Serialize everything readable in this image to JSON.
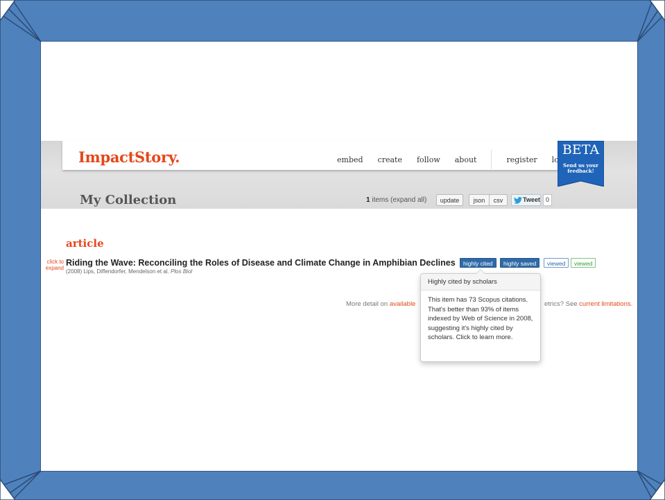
{
  "site": {
    "logo": "ImpactStory."
  },
  "nav": {
    "embed": "embed",
    "create": "create",
    "follow": "follow",
    "about": "about",
    "register": "register",
    "login": "log in"
  },
  "beta": {
    "label": "BETA",
    "line1": "Send us your",
    "line2": "feedback!"
  },
  "collection": {
    "title": "My Collection",
    "item_count": "1",
    "items_text": "items",
    "expand_all": "(expand all)",
    "update": "update",
    "json": "json",
    "csv": "csv",
    "tweet": "Tweet",
    "tweet_count": "0"
  },
  "section": "article",
  "article": {
    "expand_line1": "click to",
    "expand_line2": "expand",
    "title": "Riding the Wave: Reconciling the Roles of Disease and Climate Change in Amphibian Declines",
    "meta": "(2008) Lips, Diffendorfer, Mendelson et al.",
    "journal": "Plos Biol"
  },
  "badges": [
    {
      "label": "highly cited"
    },
    {
      "label": "highly saved"
    },
    {
      "label": "viewed"
    },
    {
      "label": "viewed"
    }
  ],
  "more_detail": {
    "prefix": "More detail on",
    "link1": "available",
    "middle": "etrics? See",
    "link2": "current limitations."
  },
  "popover": {
    "title": "Highly cited by scholars",
    "body": "This item has 73 Scopus citations. That's better than 93% of items indexed by Web of Science in 2008, suggesting it's highly cited by scholars. Click to learn more."
  },
  "colors": {
    "frame_blue": "#4f81bd",
    "frame_dark": "#385d8a",
    "brand_orange": "#e5471a",
    "badge_blue": "#2f6aa8",
    "badge_green": "#3b9a3b"
  }
}
